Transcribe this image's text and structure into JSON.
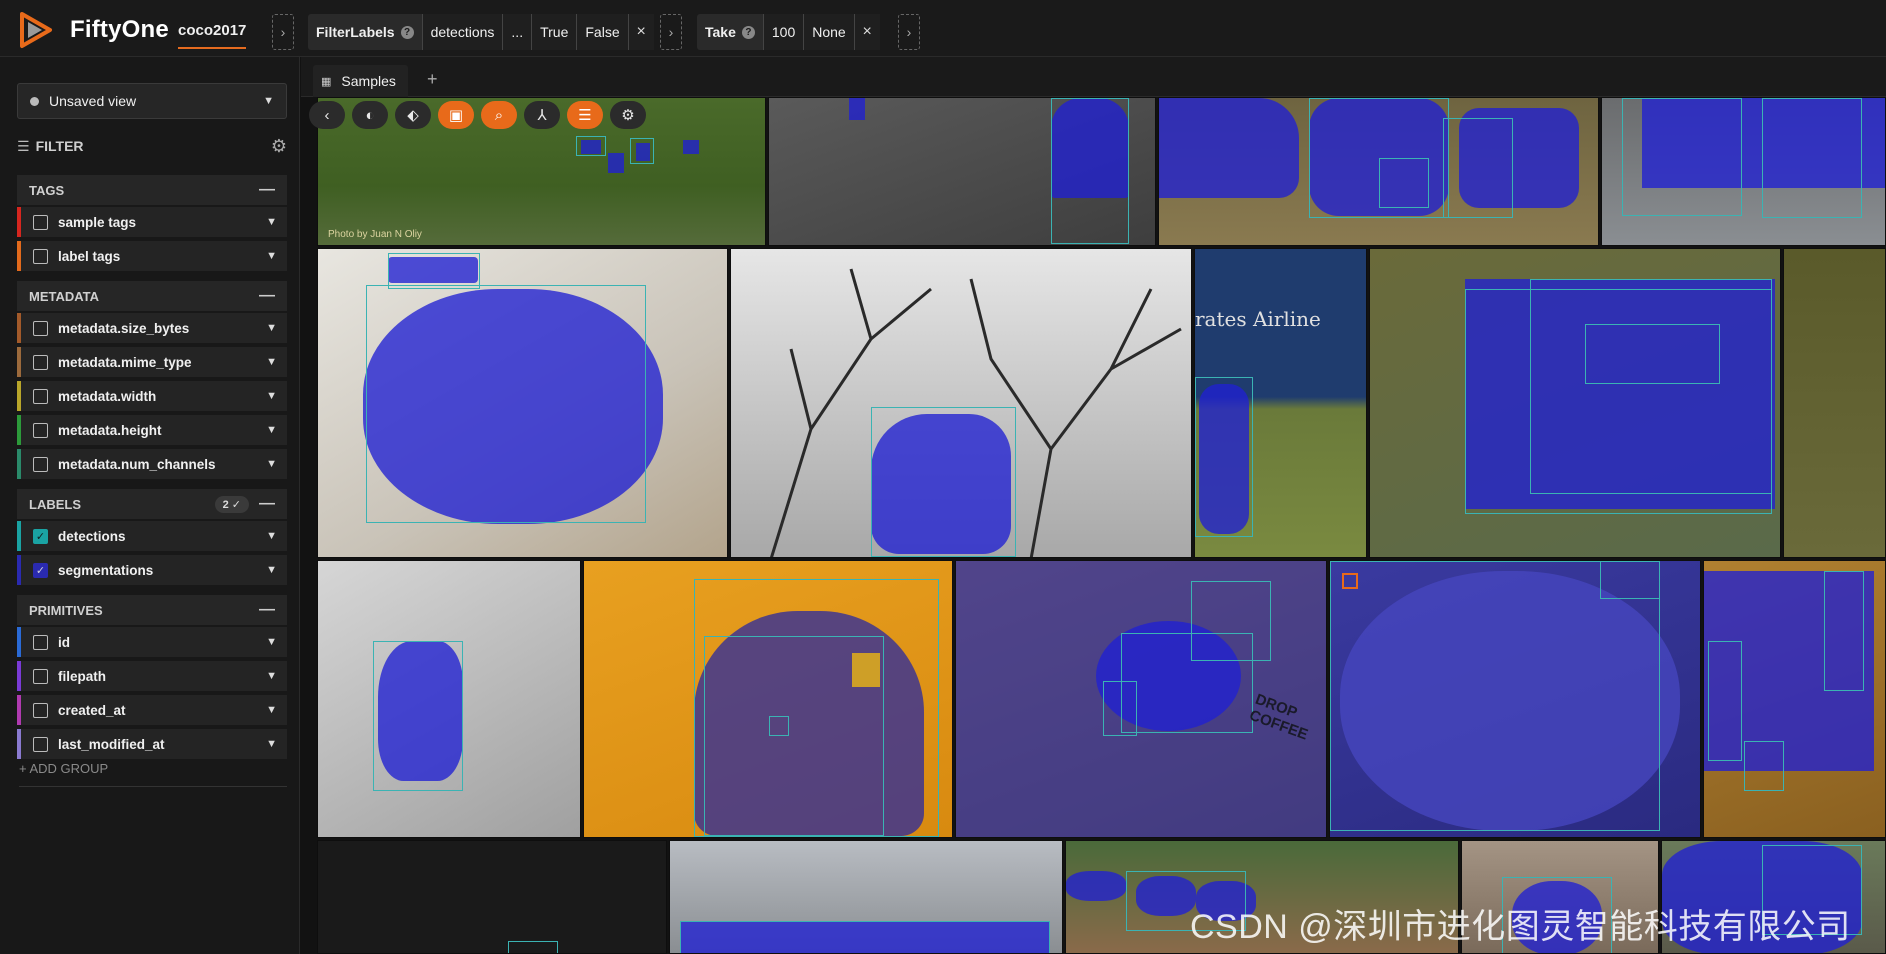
{
  "app": {
    "brand": "FiftyOne",
    "dataset": "coco2017"
  },
  "view_bar": {
    "stages": [
      {
        "name": "FilterLabels",
        "params": [
          "detections",
          "...",
          "True",
          "False"
        ]
      },
      {
        "name": "Take",
        "params": [
          "100",
          "None"
        ]
      }
    ],
    "arrow": "›",
    "close": "×",
    "help": "?"
  },
  "sidebar": {
    "view_select": "Unsaved view",
    "filter_label": "FILTER",
    "groups": {
      "tags": "TAGS",
      "metadata": "METADATA",
      "labels": "LABELS",
      "primitives": "PRIMITIVES"
    },
    "labels_badge": "2 ✓",
    "fields": {
      "sample_tags": "sample tags",
      "label_tags": "label tags",
      "size_bytes": "metadata.size_bytes",
      "mime_type": "metadata.mime_type",
      "width": "metadata.width",
      "height": "metadata.height",
      "num_channels": "metadata.num_channels",
      "detections": "detections",
      "segmentations": "segmentations",
      "id": "id",
      "filepath": "filepath",
      "created_at": "created_at",
      "last_modified_at": "last_modified_at"
    },
    "field_colors": {
      "sample_tags": "#d6261f",
      "label_tags": "#e36a1c",
      "size_bytes": "#a35a2a",
      "mime_type": "#9c6a3c",
      "width": "#b9a62a",
      "height": "#2c9a3a",
      "num_channels": "#2a8a6a",
      "detections": "#1aa3a3",
      "segmentations": "#2a2ab0",
      "id": "#2a6ad6",
      "filepath": "#7a3ad6",
      "created_at": "#b03ab0",
      "last_modified_at": "#8a7ad0"
    },
    "add_group": "+ ADD GROUP"
  },
  "main": {
    "tab_label": "Samples",
    "tab_add": "+",
    "toolbar_icons": [
      "back-icon",
      "palette-icon",
      "tag-icon",
      "crop-icon",
      "search-icon",
      "patches-icon",
      "list-icon",
      "gear-icon"
    ],
    "photo_credit": "Photo by Juan N Oliy",
    "tile_texts": {
      "airline_sign": "rates Airline",
      "drop_coffee": "DROP COFFEE"
    }
  },
  "watermark": "CSDN @深圳市进化图灵智能科技有限公司"
}
